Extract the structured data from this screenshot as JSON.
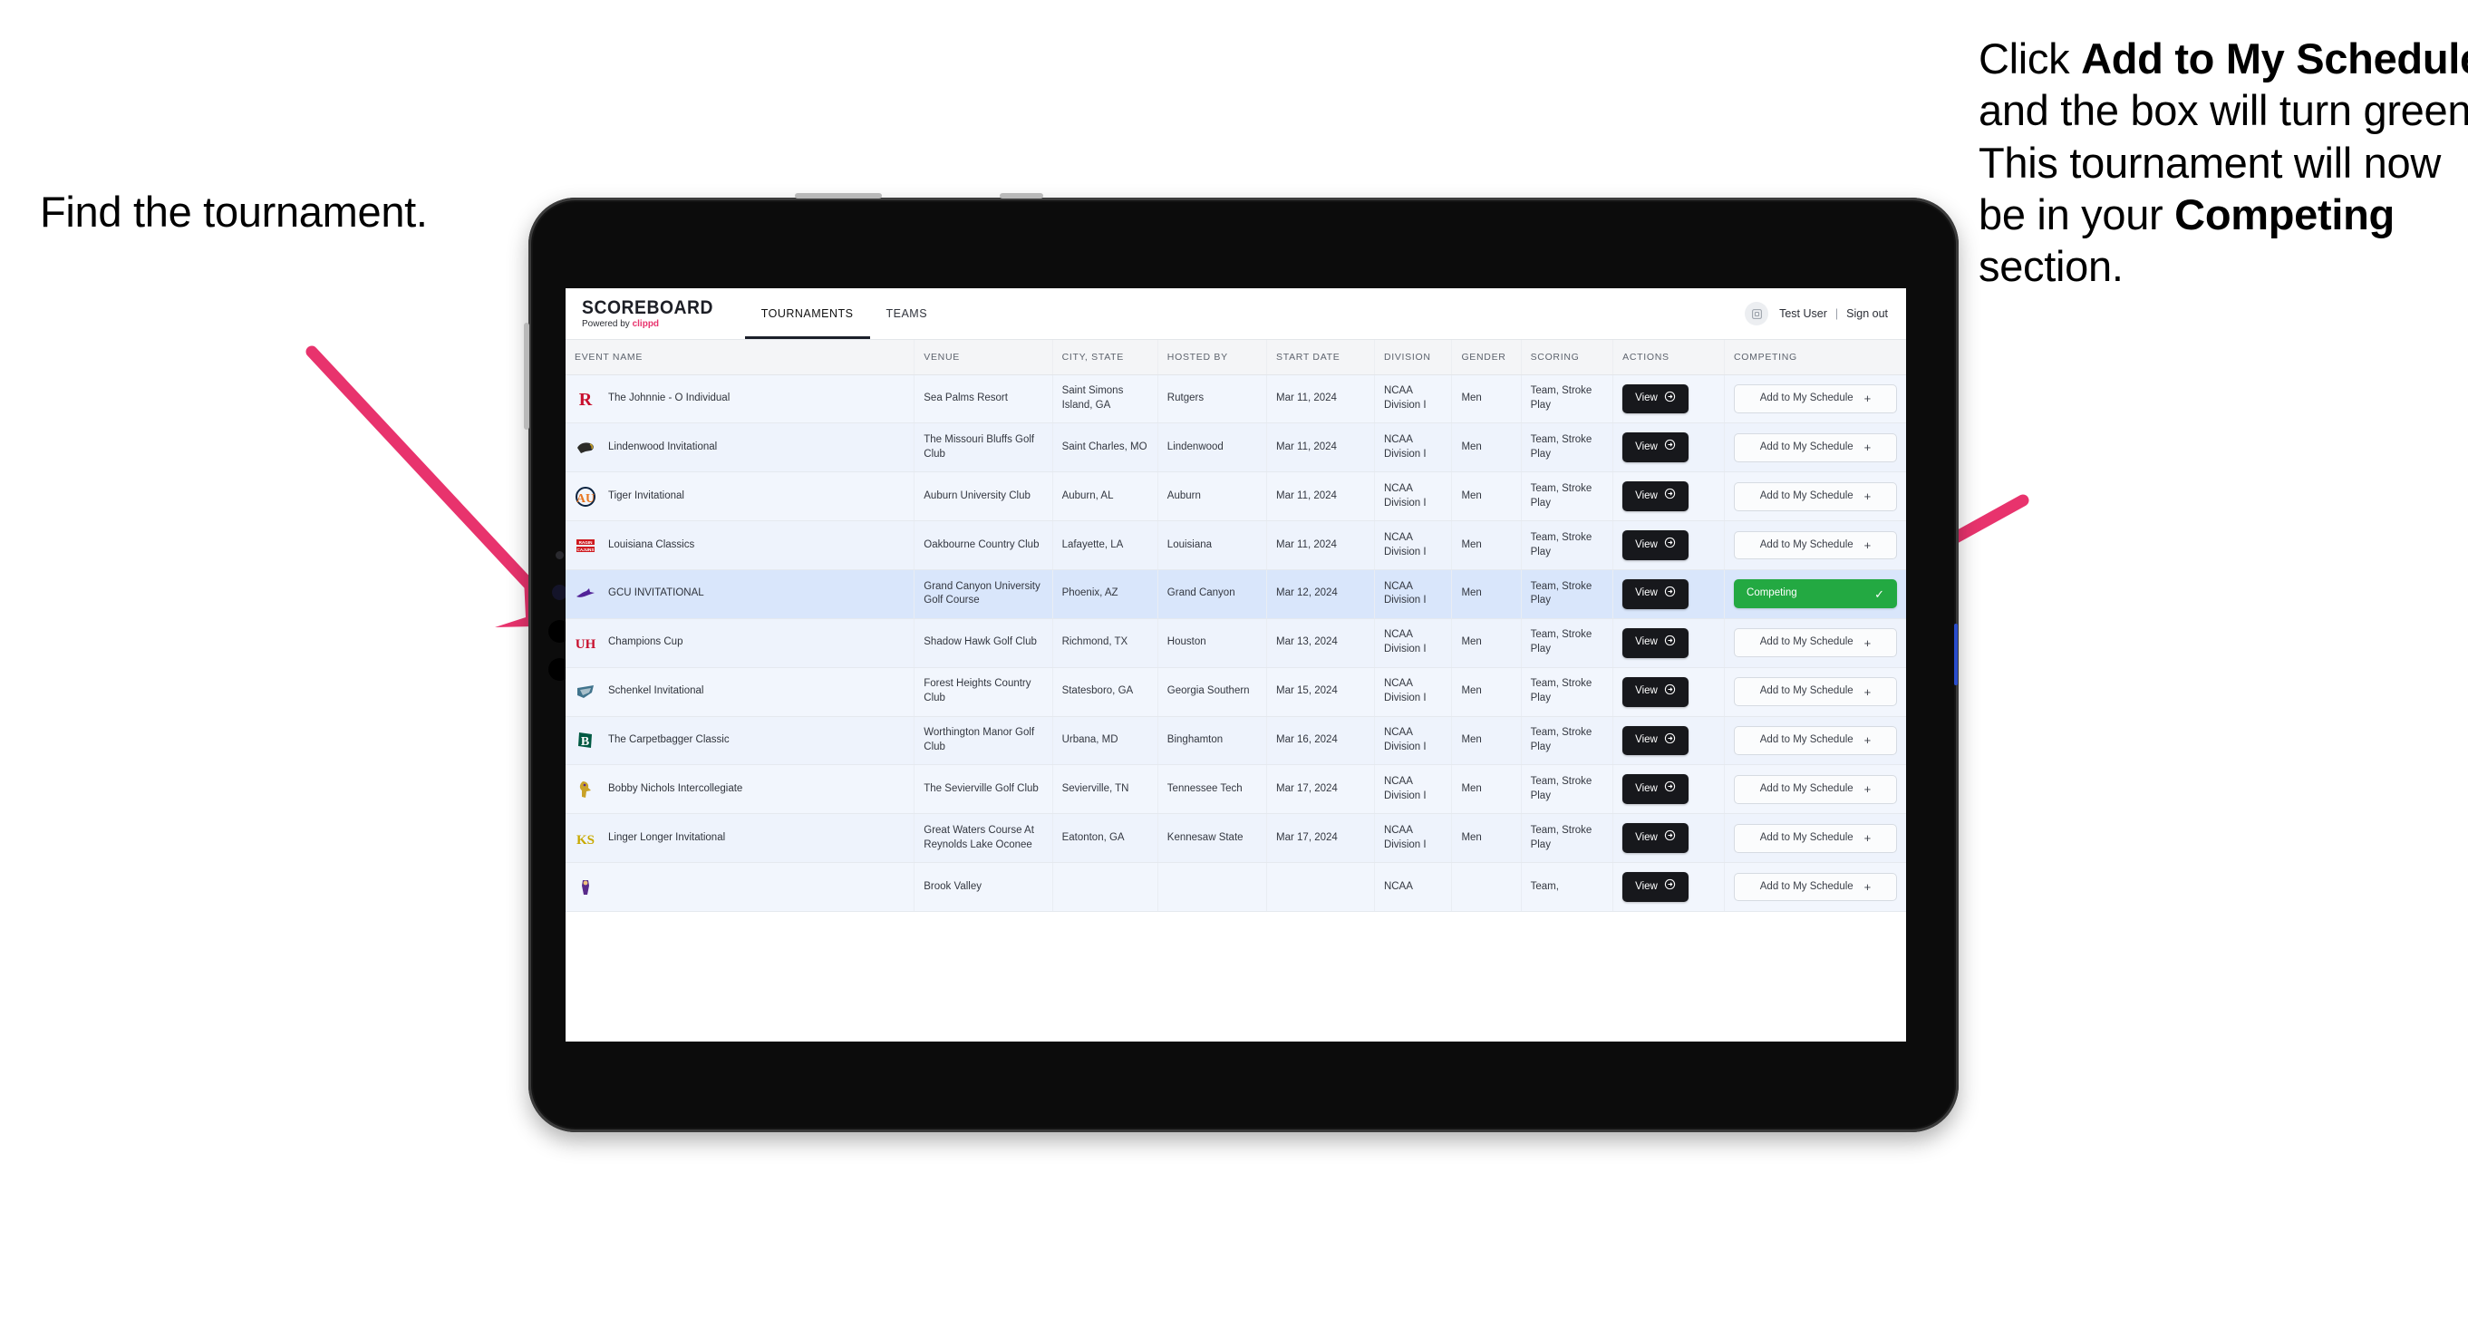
{
  "annotations": {
    "left": "Find the tournament.",
    "right_parts": [
      {
        "text": "Click ",
        "bold": false
      },
      {
        "text": "Add to My Schedule",
        "bold": true
      },
      {
        "text": " and the box will turn green. This tournament will now be in your ",
        "bold": false
      },
      {
        "text": "Competing",
        "bold": true
      },
      {
        "text": " section.",
        "bold": false
      }
    ],
    "arrow_color": "#e8336d"
  },
  "app": {
    "brand_title": "SCOREBOARD",
    "brand_sub_prefix": "Powered by ",
    "brand_sub_name": "clippd",
    "nav": [
      {
        "label": "TOURNAMENTS",
        "active": true
      },
      {
        "label": "TEAMS",
        "active": false
      }
    ],
    "user": {
      "name": "Test User",
      "separator": "|",
      "signout": "Sign out",
      "avatar_icon": "user-avatar-icon"
    }
  },
  "table": {
    "columns": [
      "EVENT NAME",
      "VENUE",
      "CITY, STATE",
      "HOSTED BY",
      "START DATE",
      "DIVISION",
      "GENDER",
      "SCORING",
      "ACTIONS",
      "COMPETING"
    ],
    "action_label": "View",
    "add_label": "Add to My Schedule",
    "add_icon": "plus-icon",
    "view_icon": "arrow-right-circle-icon",
    "competing_label": "Competing",
    "competing_icon": "check-icon",
    "competing_color": "#23a942",
    "rows": [
      {
        "logo": "rutgers-r-logo",
        "event": "The Johnnie - O Individual",
        "venue": "Sea Palms Resort",
        "city": "Saint Simons Island, GA",
        "hosted_by": "Rutgers",
        "start_date": "Mar 11, 2024",
        "division": "NCAA Division I",
        "gender": "Men",
        "scoring": "Team, Stroke Play",
        "competing": false
      },
      {
        "logo": "lindenwood-lion-logo",
        "event": "Lindenwood Invitational",
        "venue": "The Missouri Bluffs Golf Club",
        "city": "Saint Charles, MO",
        "hosted_by": "Lindenwood",
        "start_date": "Mar 11, 2024",
        "division": "NCAA Division I",
        "gender": "Men",
        "scoring": "Team, Stroke Play",
        "competing": false
      },
      {
        "logo": "auburn-au-logo",
        "event": "Tiger Invitational",
        "venue": "Auburn University Club",
        "city": "Auburn, AL",
        "hosted_by": "Auburn",
        "start_date": "Mar 11, 2024",
        "division": "NCAA Division I",
        "gender": "Men",
        "scoring": "Team, Stroke Play",
        "competing": false
      },
      {
        "logo": "ragin-cajuns-logo",
        "event": "Louisiana Classics",
        "venue": "Oakbourne Country Club",
        "city": "Lafayette, LA",
        "hosted_by": "Louisiana",
        "start_date": "Mar 11, 2024",
        "division": "NCAA Division I",
        "gender": "Men",
        "scoring": "Team, Stroke Play",
        "competing": false
      },
      {
        "logo": "grand-canyon-lopes-logo",
        "event": "GCU INVITATIONAL",
        "venue": "Grand Canyon University Golf Course",
        "city": "Phoenix, AZ",
        "hosted_by": "Grand Canyon",
        "start_date": "Mar 12, 2024",
        "division": "NCAA Division I",
        "gender": "Men",
        "scoring": "Team, Stroke Play",
        "competing": true
      },
      {
        "logo": "houston-uh-logo",
        "event": "Champions Cup",
        "venue": "Shadow Hawk Golf Club",
        "city": "Richmond, TX",
        "hosted_by": "Houston",
        "start_date": "Mar 13, 2024",
        "division": "NCAA Division I",
        "gender": "Men",
        "scoring": "Team, Stroke Play",
        "competing": false
      },
      {
        "logo": "georgia-southern-eagles-logo",
        "event": "Schenkel Invitational",
        "venue": "Forest Heights Country Club",
        "city": "Statesboro, GA",
        "hosted_by": "Georgia Southern",
        "start_date": "Mar 15, 2024",
        "division": "NCAA Division I",
        "gender": "Men",
        "scoring": "Team, Stroke Play",
        "competing": false
      },
      {
        "logo": "binghamton-b-logo",
        "event": "The Carpetbagger Classic",
        "venue": "Worthington Manor Golf Club",
        "city": "Urbana, MD",
        "hosted_by": "Binghamton",
        "start_date": "Mar 16, 2024",
        "division": "NCAA Division I",
        "gender": "Men",
        "scoring": "Team, Stroke Play",
        "competing": false
      },
      {
        "logo": "tennessee-tech-eagle-logo",
        "event": "Bobby Nichols Intercollegiate",
        "venue": "The Sevierville Golf Club",
        "city": "Sevierville, TN",
        "hosted_by": "Tennessee Tech",
        "start_date": "Mar 17, 2024",
        "division": "NCAA Division I",
        "gender": "Men",
        "scoring": "Team, Stroke Play",
        "competing": false
      },
      {
        "logo": "kennesaw-state-ksu-logo",
        "event": "Linger Longer Invitational",
        "venue": "Great Waters Course At Reynolds Lake Oconee",
        "city": "Eatonton, GA",
        "hosted_by": "Kennesaw State",
        "start_date": "Mar 17, 2024",
        "division": "NCAA Division I",
        "gender": "Men",
        "scoring": "Team, Stroke Play",
        "competing": false
      },
      {
        "logo": "east-carolina-pirates-logo",
        "event": "",
        "venue": "Brook Valley",
        "city": "",
        "hosted_by": "",
        "start_date": "",
        "division": "NCAA",
        "gender": "",
        "scoring": "Team,",
        "competing": false,
        "clipped": true
      }
    ]
  }
}
